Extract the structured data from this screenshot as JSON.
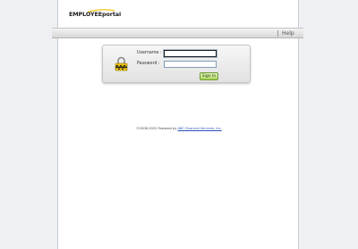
{
  "header": {
    "logo_text": "EMPLOYEEportal"
  },
  "nav": {
    "help_label": "Help"
  },
  "login": {
    "username_label": "Username :",
    "password_label": "Password :",
    "username_value": "",
    "password_value": "",
    "signin_label": "Sign In"
  },
  "footer": {
    "copyright_text": "©2006-2022 Powered by",
    "company_link": "ABC Financial Services, Inc."
  },
  "colors": {
    "page_background": "#eef0f3",
    "signin_button": "#a9d35a",
    "logo_swoosh": "#f2c200",
    "link": "#2a4fb8"
  },
  "icons": {
    "lock": "lock-icon",
    "logo_swoosh": "swoosh-icon"
  }
}
